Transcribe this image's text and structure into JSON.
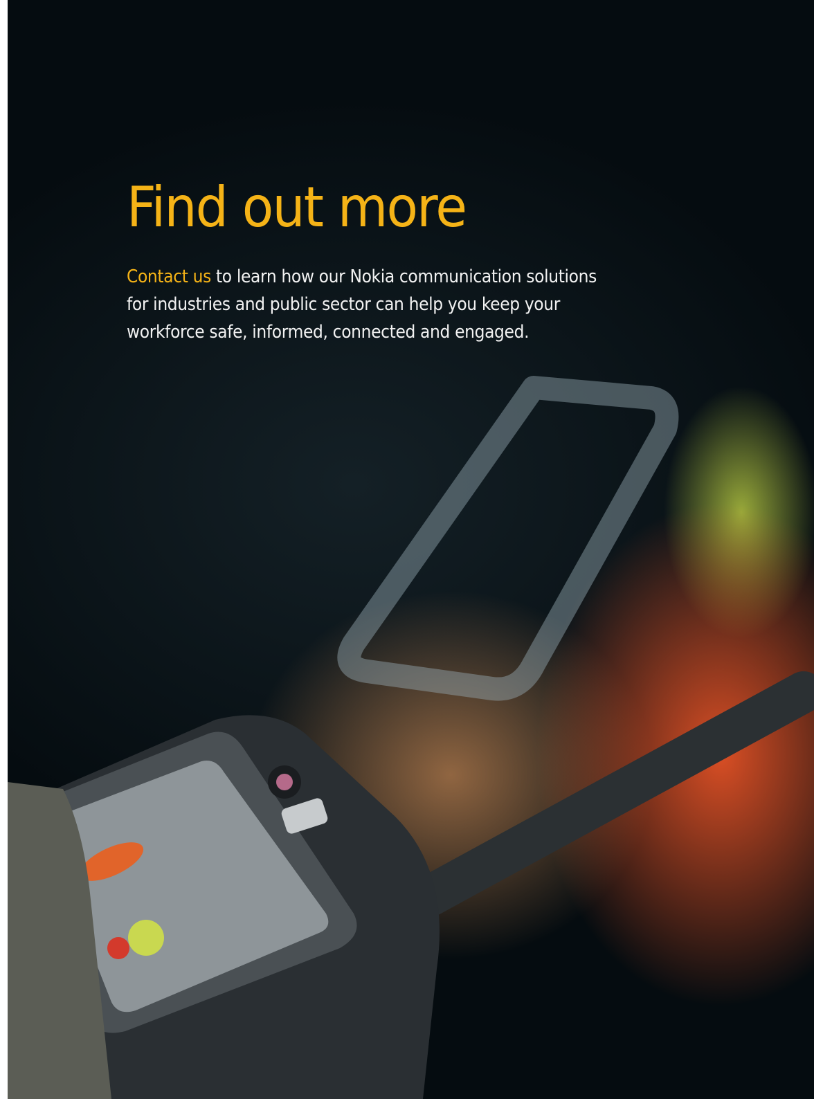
{
  "headline": "Find out more",
  "intro": {
    "link_text": "Contact us",
    "line1_rest": " to learn how our Nokia communication solutions",
    "line2": "for industries and public sector can help you keep your",
    "line3": "workforce safe, informed, connected and engaged."
  },
  "colors": {
    "accent": "#f5b317",
    "text": "#f2f2f2",
    "background": "#050b0e"
  }
}
